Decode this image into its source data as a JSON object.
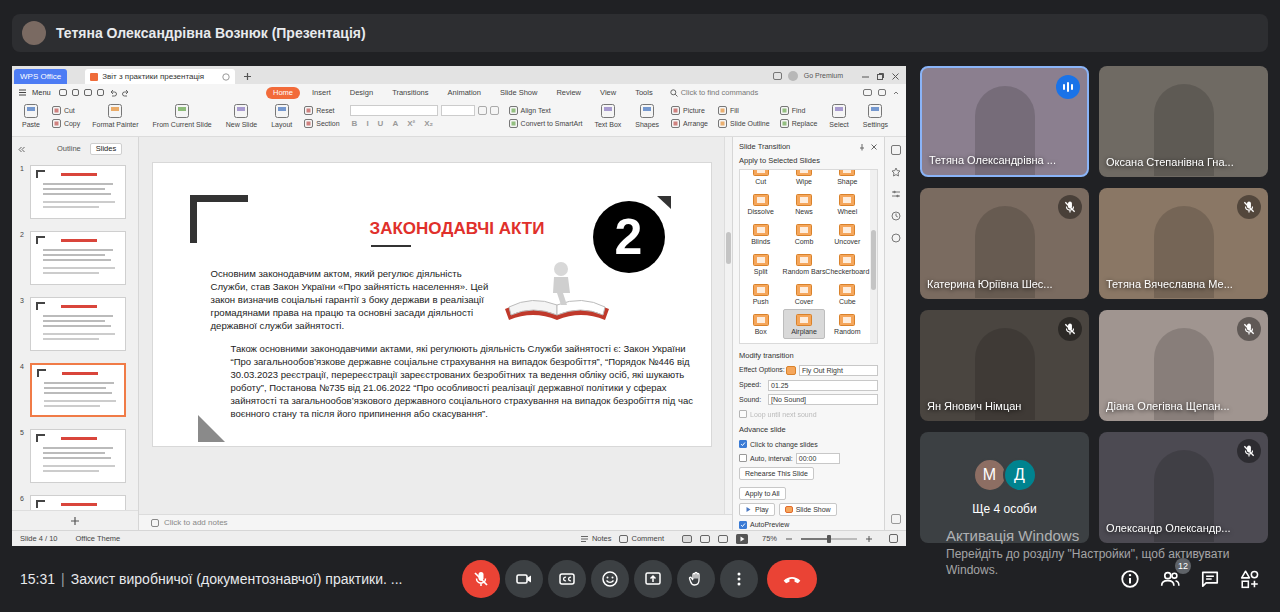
{
  "meet": {
    "presenter": "Тетяна Олександрівна Вознюк (Презентація)",
    "time": "15:31",
    "divider": "|",
    "title": "Захист виробничої (документознавчої) практики. ...",
    "mic_on": false,
    "camera_on": true,
    "people_count": "12"
  },
  "wps": {
    "app_button": "WPS Office",
    "document_tab": "Звіт з практики презентація",
    "premium": "Go Premium",
    "menu": "Menu",
    "ribbon_tabs": [
      {
        "label": "Home",
        "selected": true
      },
      {
        "label": "Insert",
        "selected": false
      },
      {
        "label": "Design",
        "selected": false
      },
      {
        "label": "Transitions",
        "selected": false
      },
      {
        "label": "Animation",
        "selected": false
      },
      {
        "label": "Slide Show",
        "selected": false
      },
      {
        "label": "Review",
        "selected": false
      },
      {
        "label": "View",
        "selected": false
      },
      {
        "label": "Tools",
        "selected": false
      }
    ],
    "search": "Click to find commands",
    "ribbon": [
      {
        "kind": "large",
        "label": "Paste"
      },
      {
        "kind": "stack",
        "labels": [
          "Cut",
          "Copy"
        ]
      },
      {
        "kind": "large",
        "label": "Format Painter"
      },
      {
        "kind": "large",
        "label": "From Current Slide"
      },
      {
        "kind": "large",
        "label": "New Slide"
      },
      {
        "kind": "large",
        "label": "Layout"
      },
      {
        "kind": "stack",
        "labels": [
          "Reset",
          "Section"
        ]
      },
      {
        "kind": "font",
        "buttons": [
          "B",
          "I",
          "U",
          "A",
          "X²",
          "X₂"
        ]
      },
      {
        "kind": "stack",
        "labels": [
          "Align Text",
          "Convert to SmartArt"
        ]
      },
      {
        "kind": "large",
        "label": "Text Box"
      },
      {
        "kind": "large",
        "label": "Shapes"
      },
      {
        "kind": "stack",
        "labels": [
          "Picture",
          "Arrange"
        ]
      },
      {
        "kind": "stack",
        "labels": [
          "Fill",
          "Slide Outline"
        ]
      },
      {
        "kind": "stack",
        "labels": [
          "Find",
          "Replace"
        ]
      },
      {
        "kind": "large",
        "label": "Select"
      },
      {
        "kind": "large",
        "label": "Settings"
      }
    ],
    "pane_tabs": [
      {
        "label": "Outline",
        "selected": false
      },
      {
        "label": "Slides",
        "selected": true
      }
    ],
    "thumbnails": [
      {
        "number": "1",
        "selected": false
      },
      {
        "number": "2",
        "selected": false
      },
      {
        "number": "3",
        "selected": false
      },
      {
        "number": "4",
        "selected": true
      },
      {
        "number": "5",
        "selected": false
      },
      {
        "number": "6",
        "selected": false
      }
    ],
    "slide": {
      "title": "ЗАКОНОДАВЧІ АКТИ",
      "badge": "2",
      "paragraphs": [
        "Основним законодавчим актом, який регулює діяльність Служби, став Закон України «Про зайнятість населення». Цей закон визначив соціальні гарантії з боку держави в реалізації громадянами права на працю та основні засади діяльності державної служби зайнятості.",
        "Також основними законодавчими актами, які регулюють діяльність Служби зайнятості є: Закон України “Про загальнообов’язкове державне соціальне страхування на випадок безробіття”, “Порядок №446 від 30.03.2023 реєстрації, перереєстрації зареєстрованих безробітних та ведення обліку осіб, які шукають роботу”, Постанова №735 від 21.06.2022 “Про особливості реалізації державної політики у сферах зайнятості та загальнообов’язкового державного соціального страхування на випадок безробіття під час воєнного стану та після його припинення або скасування”."
      ]
    },
    "notes_placeholder": "Click to add notes",
    "status": {
      "slide": "Slide 4 / 10",
      "theme": "Office Theme",
      "notes": "Notes",
      "comment": "Comment",
      "zoom": "75%",
      "zoom_level": 0.5
    },
    "transition": {
      "title": "Slide Transition",
      "apply_label": "Apply to Selected Slides",
      "effects": [
        {
          "label": "Cut",
          "selected": false
        },
        {
          "label": "Wipe",
          "selected": false
        },
        {
          "label": "Shape",
          "selected": false
        },
        {
          "label": "Dissolve",
          "selected": false
        },
        {
          "label": "News",
          "selected": false
        },
        {
          "label": "Wheel",
          "selected": false
        },
        {
          "label": "Blinds",
          "selected": false
        },
        {
          "label": "Comb",
          "selected": false
        },
        {
          "label": "Uncover",
          "selected": false
        },
        {
          "label": "Split",
          "selected": false
        },
        {
          "label": "Random Bars",
          "selected": false
        },
        {
          "label": "Checkerboard",
          "selected": false
        },
        {
          "label": "Push",
          "selected": false
        },
        {
          "label": "Cover",
          "selected": false
        },
        {
          "label": "Cube",
          "selected": false
        },
        {
          "label": "Box",
          "selected": false
        },
        {
          "label": "Airplane",
          "selected": true
        },
        {
          "label": "Random",
          "selected": false
        }
      ],
      "modify_label": "Modify transition",
      "effect_options_label": "Effect Options:",
      "effect_option": "Fly Out Right",
      "speed_label": "Speed:",
      "speed": "01.25",
      "sound_label": "Sound:",
      "sound": "[No Sound]",
      "loop": {
        "label": "Loop until next sound",
        "checked": false,
        "disabled": true
      },
      "advance_label": "Advance slide",
      "on_click": {
        "label": "Click to change slides",
        "checked": true
      },
      "auto": {
        "label": "Auto, interval:",
        "checked": false,
        "value": "00:00"
      },
      "rehearse": "Rehearse This Slide",
      "apply_all": "Apply to All",
      "play": "Play",
      "slide_show": "Slide Show",
      "autopreview": {
        "label": "AutoPreview",
        "checked": true
      }
    }
  },
  "participants": [
    {
      "name": "Тетяна Олександрівна ...",
      "muted": false,
      "speaking": true
    },
    {
      "name": "Оксана Степанівна Гна...",
      "muted": false,
      "speaking": false
    },
    {
      "name": "Катерина Юріївна Шес...",
      "muted": true,
      "speaking": false
    },
    {
      "name": "Тетяна Вячеславна Ме...",
      "muted": true,
      "speaking": false
    },
    {
      "name": "Ян Янович Німцан",
      "muted": true,
      "speaking": false
    },
    {
      "name": "Діана Олегівна Щепан...",
      "muted": true,
      "speaking": false
    },
    {
      "name": "Олександр Олександр...",
      "muted": true,
      "speaking": false
    }
  ],
  "others": {
    "label": "Ще 4 особи",
    "avatars": [
      {
        "letter": "М",
        "color": "#8d6e63"
      },
      {
        "letter": "Д",
        "color": "#00838f"
      }
    ]
  },
  "watermark": {
    "title": "Активація Windows",
    "text": "Перейдіть до розділу \"Настройки\", щоб активувати Windows."
  }
}
